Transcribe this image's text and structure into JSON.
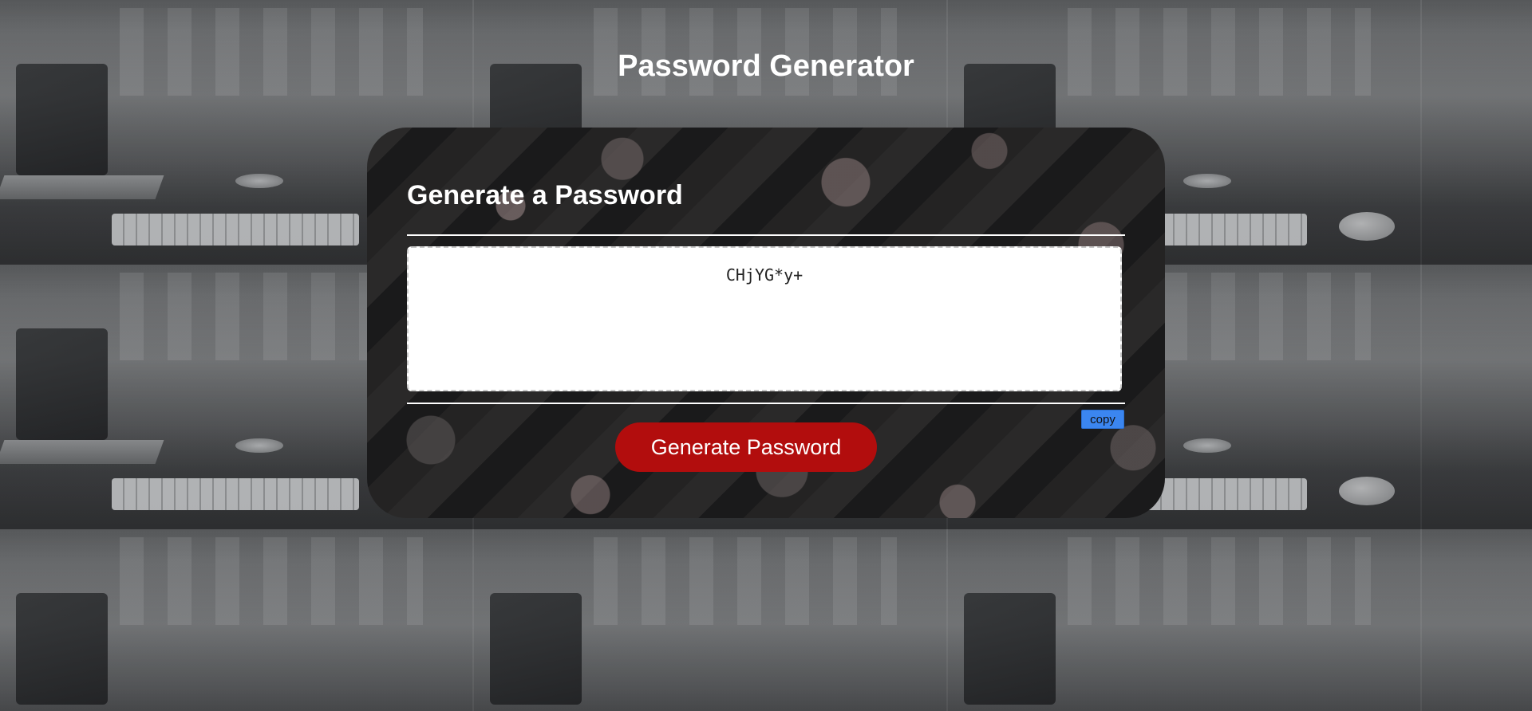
{
  "header": {
    "title": "Password Generator"
  },
  "card": {
    "heading": "Generate a Password",
    "password_value": "CHjYG*y+",
    "copy_label": "copy",
    "generate_label": "Generate Password"
  },
  "colors": {
    "generate_button": "#b20d0d",
    "copy_button": "#3b86f0",
    "text": "#ffffff"
  }
}
